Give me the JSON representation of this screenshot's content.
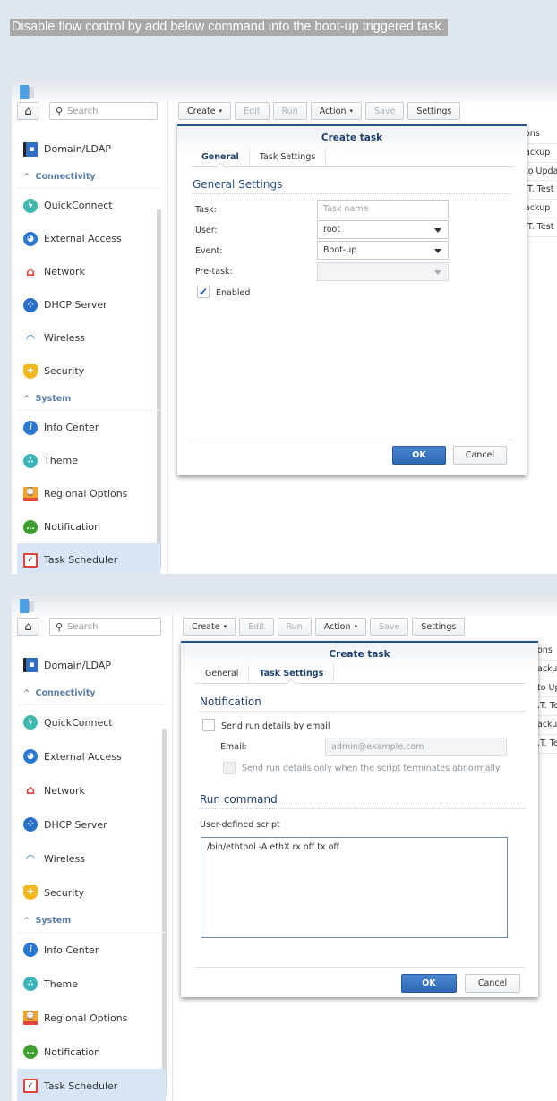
{
  "caption": "Disable flow control by add below command into the boot-up triggered task.",
  "search_placeholder": "Search",
  "toolbar": {
    "create": "Create",
    "edit": "Edit",
    "run": "Run",
    "action": "Action",
    "save": "Save",
    "settings": "Settings"
  },
  "sidebar": {
    "domain": "Domain/LDAP",
    "section_connectivity": "Connectivity",
    "quickconnect": "QuickConnect",
    "external_access": "External Access",
    "network": "Network",
    "dhcp": "DHCP Server",
    "wireless": "Wireless",
    "security": "Security",
    "section_system": "System",
    "info_center": "Info Center",
    "theme": "Theme",
    "regional": "Regional Options",
    "notification": "Notification",
    "task_scheduler": "Task Scheduler"
  },
  "bg_list": [
    "ons",
    "ackup",
    "to Updat",
    ".T. Test",
    "ackup",
    ".T. Test"
  ],
  "bg_list2": [
    "ons",
    "acku",
    "to Up",
    ".T. Te",
    "acku",
    ".T. Te"
  ],
  "dialog1": {
    "title": "Create task",
    "tab_general": "General",
    "tab_task_settings": "Task Settings",
    "section": "General Settings",
    "task_label": "Task:",
    "task_placeholder": "Task name",
    "user_label": "User:",
    "user_value": "root",
    "event_label": "Event:",
    "event_value": "Boot-up",
    "pretask_label": "Pre-task:",
    "pretask_value": "",
    "enabled_label": "Enabled",
    "enabled_checked": true,
    "ok": "OK",
    "cancel": "Cancel"
  },
  "dialog2": {
    "title": "Create task",
    "tab_general": "General",
    "tab_task_settings": "Task Settings",
    "notification_section": "Notification",
    "send_email_label": "Send run details by email",
    "send_email_checked": false,
    "email_label": "Email:",
    "email_placeholder": "admin@example.com",
    "abnormal_label": "Send run details only when the script terminates abnormally",
    "run_section": "Run command",
    "script_label": "User-defined script",
    "script_value": "/bin/ethtool -A ethX rx off tx off",
    "ok": "OK",
    "cancel": "Cancel"
  }
}
